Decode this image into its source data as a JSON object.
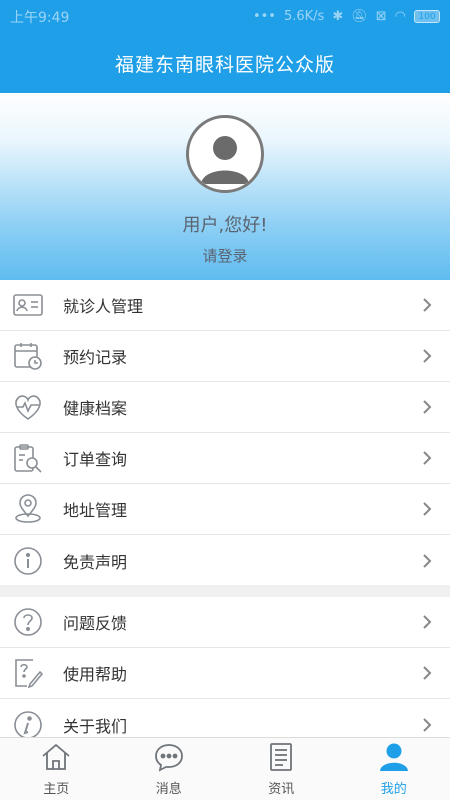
{
  "status_bar": {
    "time": "上午9:49",
    "network_speed": "5.6K/s",
    "battery": "100"
  },
  "header": {
    "title": "福建东南眼科医院公众版"
  },
  "profile": {
    "greeting": "用户,您好!",
    "login_label": "请登录"
  },
  "menu_group_1": [
    {
      "label": "就诊人管理",
      "icon": "patient-card-icon"
    },
    {
      "label": "预约记录",
      "icon": "calendar-clock-icon"
    },
    {
      "label": "健康档案",
      "icon": "heart-pulse-icon"
    },
    {
      "label": "订单查询",
      "icon": "clipboard-search-icon"
    },
    {
      "label": "地址管理",
      "icon": "location-pin-icon"
    },
    {
      "label": "免责声明",
      "icon": "info-circle-icon"
    }
  ],
  "menu_group_2": [
    {
      "label": "问题反馈",
      "icon": "question-circle-icon"
    },
    {
      "label": "使用帮助",
      "icon": "help-edit-icon"
    },
    {
      "label": "关于我们",
      "icon": "info-italic-icon"
    }
  ],
  "tab_bar": {
    "tabs": [
      {
        "label": "主页",
        "icon": "home-icon"
      },
      {
        "label": "消息",
        "icon": "chat-bubble-icon"
      },
      {
        "label": "资讯",
        "icon": "news-icon"
      },
      {
        "label": "我的",
        "icon": "user-icon"
      }
    ],
    "active_index": 3
  },
  "colors": {
    "brand_blue": "#1f9fe8",
    "icon_gray": "#8a8f96",
    "text_dark": "#333333"
  }
}
